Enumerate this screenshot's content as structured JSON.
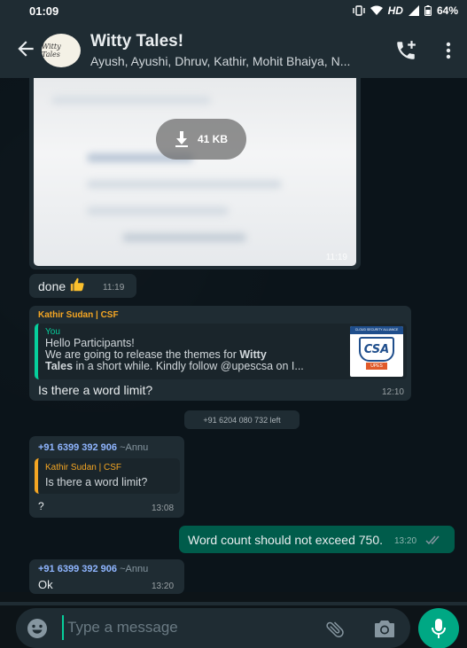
{
  "status_bar": {
    "time": "01:09",
    "network": "HD",
    "battery": "64%"
  },
  "header": {
    "title": "Witty Tales!",
    "members": "Ayush, Ayushi, Dhruv, Kathir, Mohit Bhaiya, N...",
    "avatar_text": "Witty Tales",
    "icons": [
      "back-arrow-icon",
      "add-call-icon",
      "more-vert-icon"
    ]
  },
  "messages": {
    "image": {
      "download_size": "41 KB",
      "time": "11:19"
    },
    "done": {
      "text": "done",
      "emoji": "thumbs-up",
      "time": "11:19"
    },
    "kathir": {
      "sender": "Kathir Sudan | CSF",
      "quote_sender": "You",
      "quote_line1": "Hello Participants!",
      "quote_line2_pre": "We are going to release the themes for ",
      "quote_line2_bold": "Witty",
      "quote_line3_bold": "Tales",
      "quote_line3_post": " in a short while. Kindly follow @upescsa on I...",
      "thumb_header": "CLOUD SECURITY ALLIANCE",
      "thumb_logo": "CSA",
      "thumb_footer": "UPES",
      "text": "Is there a word limit?",
      "time": "12:10"
    },
    "system_notice": "+91 6204 080 732 left",
    "annu_reply": {
      "sender_number": "+91 6399 392 906",
      "sender_name": "~Annu",
      "quote_sender": "Kathir Sudan | CSF",
      "quote_text": "Is there a word limit?",
      "text": "?",
      "time": "13:08"
    },
    "outgoing": {
      "text": "Word count should not exceed 750.",
      "time": "13:20",
      "status": "read"
    },
    "annu_ok": {
      "sender_number": "+91 6399 392 906",
      "sender_name": "~Annu",
      "text": "Ok",
      "time": "13:20"
    }
  },
  "composer": {
    "placeholder": "Type a message",
    "icons": [
      "emoji-icon",
      "attach-icon",
      "camera-icon",
      "mic-icon"
    ]
  },
  "colors": {
    "header_bg": "#1f2c33",
    "chat_bg": "#0b141a",
    "incoming_bubble": "#1f2c33",
    "outgoing_bubble": "#005c4b",
    "accent": "#00a884",
    "kathir_name": "#f5a623",
    "annu_name": "#8fb5ff"
  }
}
